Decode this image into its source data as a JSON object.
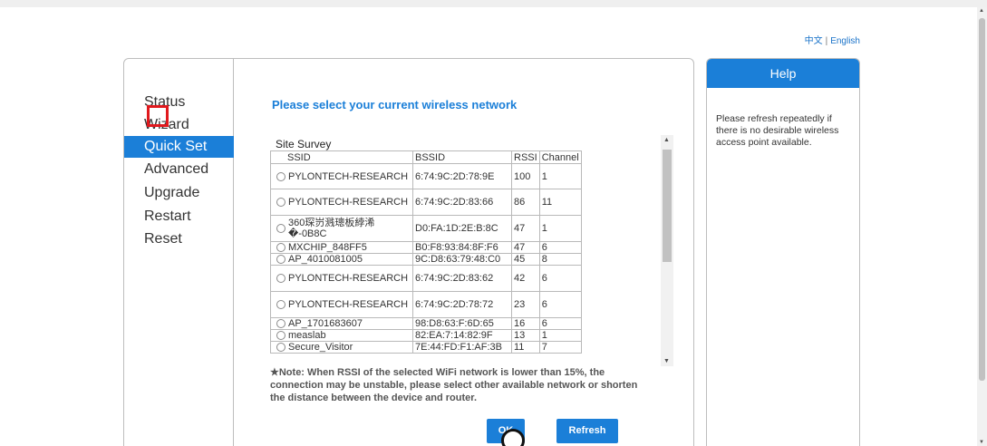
{
  "lang": {
    "zh": "中文",
    "sep": "|",
    "en": "English"
  },
  "nav": [
    {
      "label": "Status",
      "active": false
    },
    {
      "label": "Wizard",
      "active": false
    },
    {
      "label": "Quick Set",
      "active": true
    },
    {
      "label": "Advanced",
      "active": false
    },
    {
      "label": "Upgrade",
      "active": false
    },
    {
      "label": "Restart",
      "active": false
    },
    {
      "label": "Reset",
      "active": false
    }
  ],
  "main": {
    "title": "Please select your current wireless network",
    "survey_label": "Site Survey",
    "columns": [
      "SSID",
      "BSSID",
      "RSSI",
      "Channel"
    ],
    "rows": [
      {
        "ssid": "PYLONTECH-RESEARCH",
        "bssid": "6:74:9C:2D:78:9E",
        "rssi": "100",
        "channel": "1"
      },
      {
        "ssid": "PYLONTECH-RESEARCH",
        "bssid": "6:74:9C:2D:83:66",
        "rssi": "86",
        "channel": "11"
      },
      {
        "ssid": "360琛岃溅璁板綍浠�-0B8C",
        "bssid": "D0:FA:1D:2E:B:8C",
        "rssi": "47",
        "channel": "1"
      },
      {
        "ssid": "MXCHIP_848FF5",
        "bssid": "B0:F8:93:84:8F:F6",
        "rssi": "47",
        "channel": "6"
      },
      {
        "ssid": "AP_4010081005",
        "bssid": "9C:D8:63:79:48:C0",
        "rssi": "45",
        "channel": "8"
      },
      {
        "ssid": "PYLONTECH-RESEARCH",
        "bssid": "6:74:9C:2D:83:62",
        "rssi": "42",
        "channel": "6"
      },
      {
        "ssid": "PYLONTECH-RESEARCH",
        "bssid": "6:74:9C:2D:78:72",
        "rssi": "23",
        "channel": "6"
      },
      {
        "ssid": "AP_1701683607",
        "bssid": "98:D8:63:F:6D:65",
        "rssi": "16",
        "channel": "6"
      },
      {
        "ssid": "measlab",
        "bssid": "82:EA:7:14:82:9F",
        "rssi": "13",
        "channel": "1"
      },
      {
        "ssid": "Secure_Visitor",
        "bssid": "7E:44:FD:F1:AF:3B",
        "rssi": "11",
        "channel": "7"
      }
    ],
    "note": "★Note: When RSSI of the selected WiFi network is lower than 15%, the connection may be unstable, please select other available network or shorten the distance between the device and router.",
    "ok_label": "OK",
    "refresh_label": "Refresh"
  },
  "help": {
    "title": "Help",
    "text": "Please refresh repeatedly if there is no desirable wireless access point available."
  }
}
